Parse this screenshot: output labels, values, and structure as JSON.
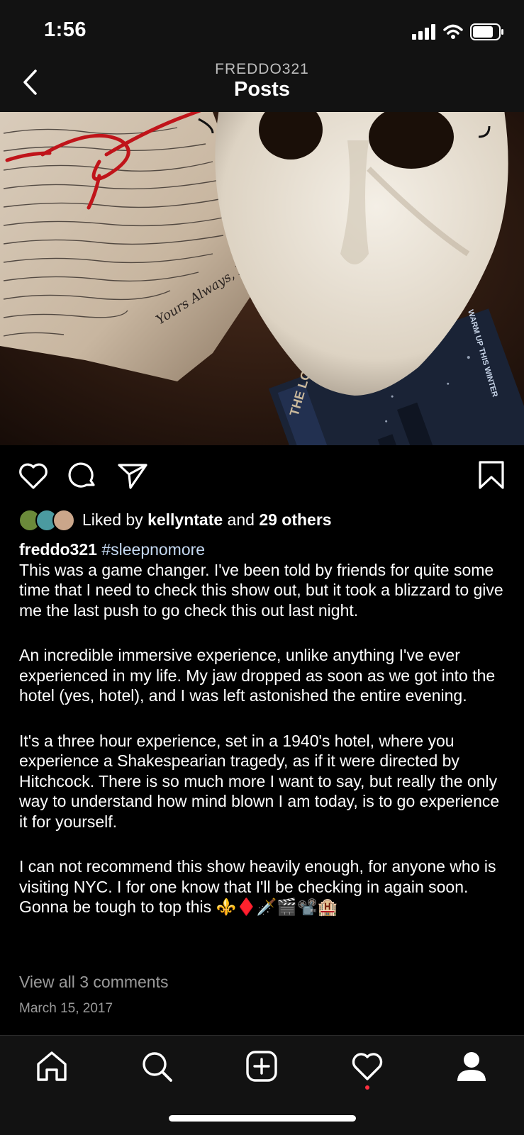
{
  "status": {
    "time": "1:56"
  },
  "nav": {
    "username": "FREDDO321",
    "title": "Posts"
  },
  "post": {
    "liked_by_prefix": "Liked by ",
    "liked_by_user": "kellyntate",
    "liked_by_mid": " and ",
    "liked_by_others": "29 others",
    "author": "freddo321",
    "hashtag": "#sleepnomore",
    "paragraphs": [
      "This was a game changer. I've been told by friends for quite some time that I need to check this show out, but it took a blizzard to give me the last push to go check this out last night.",
      "An incredible immersive experience, unlike anything I've ever experienced in my life. My jaw dropped as soon as we got into the hotel (yes, hotel), and I was left astonished the entire evening.",
      "It's a three hour experience, set in a 1940's hotel, where you experience a Shakespearian tragedy, as if it were directed by Hitchcock. There is so much more I want to say, but really the only way to understand how mind blown I am today, is to go experience it for yourself.",
      "I can not recommend this show heavily enough, for anyone who is visiting NYC. I for one know that I'll be checking in again soon. Gonna be tough to top this ⚜️♦️🗡️🎬📽️🏨"
    ],
    "view_comments": "View all 3 comments",
    "date": "March 15, 2017",
    "photo_text": {
      "signature": "Yours Always, Macbeth",
      "book_spine": "THE LODGE AT GALLOW",
      "book_cover": "WARM UP THIS WINTER"
    }
  },
  "icons": {
    "back": "chevron-left-icon",
    "like": "heart-icon",
    "comment": "comment-icon",
    "share": "paper-plane-icon",
    "save": "bookmark-icon",
    "home": "home-icon",
    "search": "search-icon",
    "new_post": "plus-square-icon",
    "activity": "heart-icon",
    "profile": "profile-icon"
  },
  "colors": {
    "hashtag": "#c5d9f2",
    "notification_dot": "#ff3040",
    "muted_text": "#9a9a9a"
  }
}
